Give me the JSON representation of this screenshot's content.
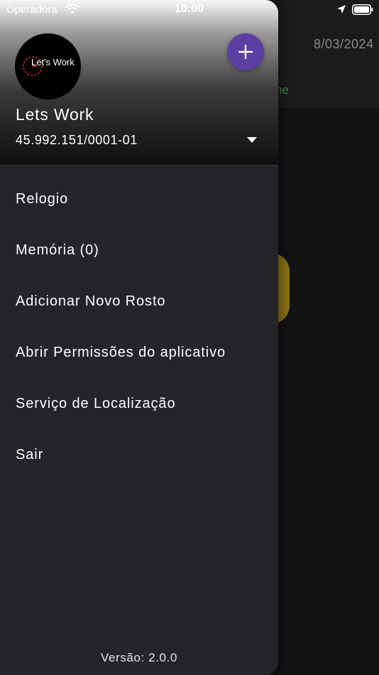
{
  "status_bar": {
    "carrier": "Operadora",
    "time": "10:00"
  },
  "background": {
    "date": "8/03/2024",
    "status": "ne"
  },
  "drawer": {
    "logo_text": "Let's Work",
    "add_button_icon": "plus-icon",
    "company_name": "Lets Work",
    "company_id": "45.992.151/0001-01",
    "menu_items": [
      "Relogio",
      "Memória (0)",
      "Adicionar Novo Rosto",
      "Abrir Permissões do aplicativo",
      "Serviço de Localização",
      "Sair"
    ],
    "version": "Versão: 2.0.0"
  },
  "colors": {
    "drawer_background": "#252429",
    "accent_button": "#5b3fa3",
    "background_button": "#8a7214",
    "status_green": "#3e8a3a"
  }
}
